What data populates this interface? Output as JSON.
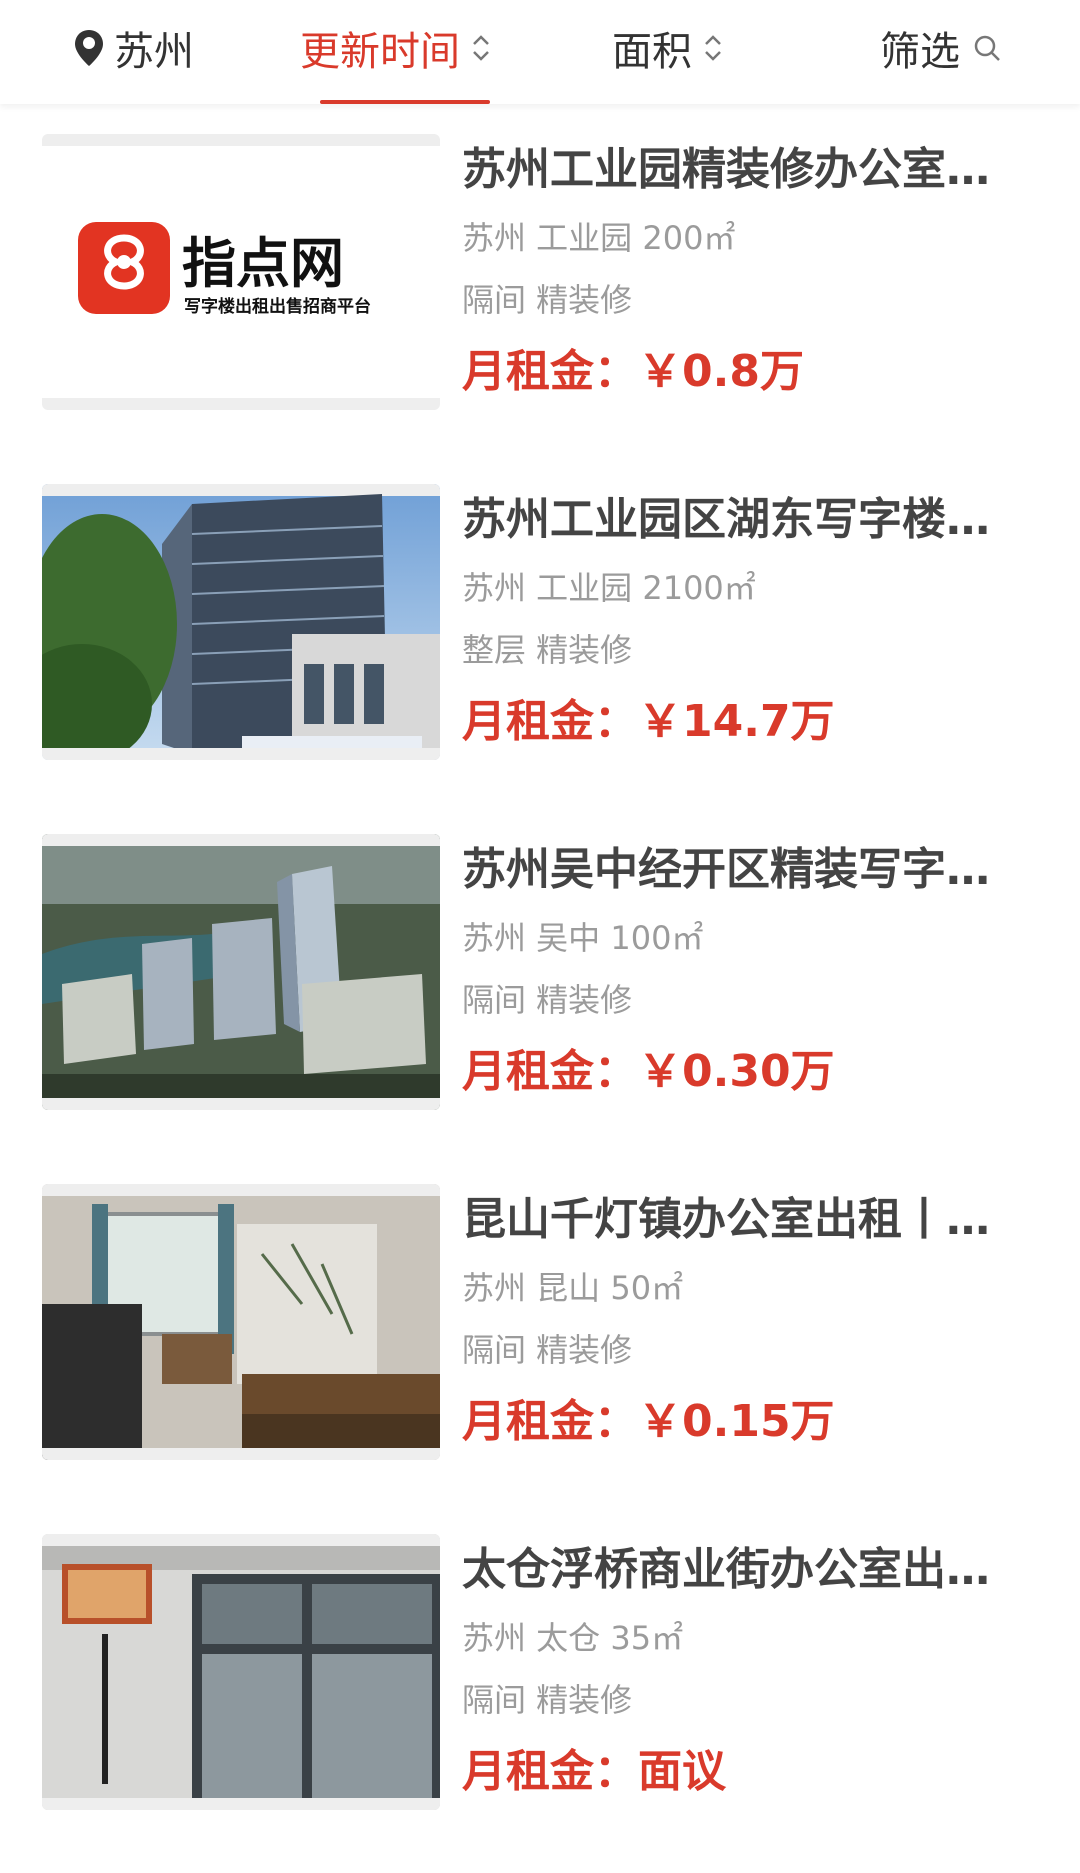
{
  "header": {
    "city": "苏州",
    "sort_time": "更新时间",
    "sort_area": "面积",
    "filter": "筛选"
  },
  "listings": [
    {
      "title": "苏州工业园精装修办公室…",
      "meta": "苏州 工业园 200㎡",
      "tags": "隔间 精装修",
      "price_label": "月租金：",
      "price_value": "￥0.8万",
      "image": {
        "logo_text": "指点网",
        "logo_sub": "写字楼出租出售招商平台"
      }
    },
    {
      "title": "苏州工业园区湖东写字楼…",
      "meta": "苏州 工业园 2100㎡",
      "tags": "整层 精装修",
      "price_label": "月租金：",
      "price_value": "￥14.7万"
    },
    {
      "title": "苏州吴中经开区精装写字…",
      "meta": "苏州 吴中 100㎡",
      "tags": "隔间 精装修",
      "price_label": "月租金：",
      "price_value": "￥0.30万"
    },
    {
      "title": "昆山千灯镇办公室出租丨…",
      "meta": "苏州 昆山 50㎡",
      "tags": "隔间 精装修",
      "price_label": "月租金：",
      "price_value": "￥0.15万"
    },
    {
      "title": "太仓浮桥商业街办公室出…",
      "meta": "苏州 太仓 35㎡",
      "tags": "隔间 精装修",
      "price_label": "月租金：",
      "price_value": "面议"
    }
  ],
  "colors": {
    "accent": "#d93a2b",
    "title": "#444444",
    "meta": "#9b9b9b"
  }
}
